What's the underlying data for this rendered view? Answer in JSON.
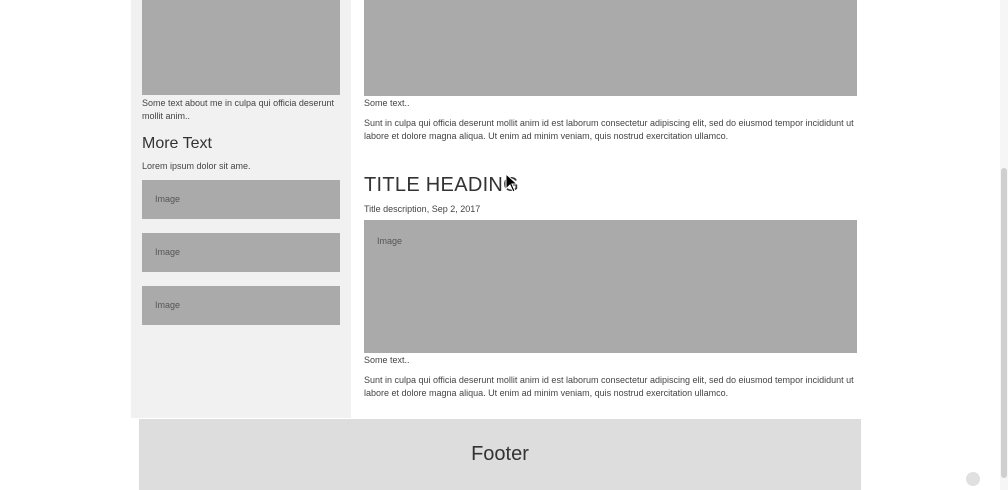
{
  "sidebar": {
    "about_text": "Some text about me in culpa qui officia deserunt mollit anim..",
    "more_heading": "More Text",
    "lorem": "Lorem ipsum dolor sit ame.",
    "images": [
      "Image",
      "Image",
      "Image"
    ]
  },
  "main": {
    "post1": {
      "some_text": "Some text..",
      "paragraph": "Sunt in culpa qui officia deserunt mollit anim id est laborum consectetur adipiscing elit, sed do eiusmod tempor incididunt ut labore et dolore magna aliqua. Ut enim ad minim veniam, quis nostrud exercitation ullamco."
    },
    "post2": {
      "title": "TITLE HEADING",
      "description": "Title description, Sep 2, 2017",
      "image_label": "Image",
      "some_text": "Some text..",
      "paragraph": "Sunt in culpa qui officia deserunt mollit anim id est laborum consectetur adipiscing elit, sed do eiusmod tempor incididunt ut labore et dolore magna aliqua. Ut enim ad minim veniam, quis nostrud exercitation ullamco."
    }
  },
  "footer": {
    "label": "Footer"
  },
  "colors": {
    "placeholder_gray": "#aaaaaa",
    "sidebar_bg": "#f1f1f1",
    "footer_bg": "#dddddd"
  }
}
